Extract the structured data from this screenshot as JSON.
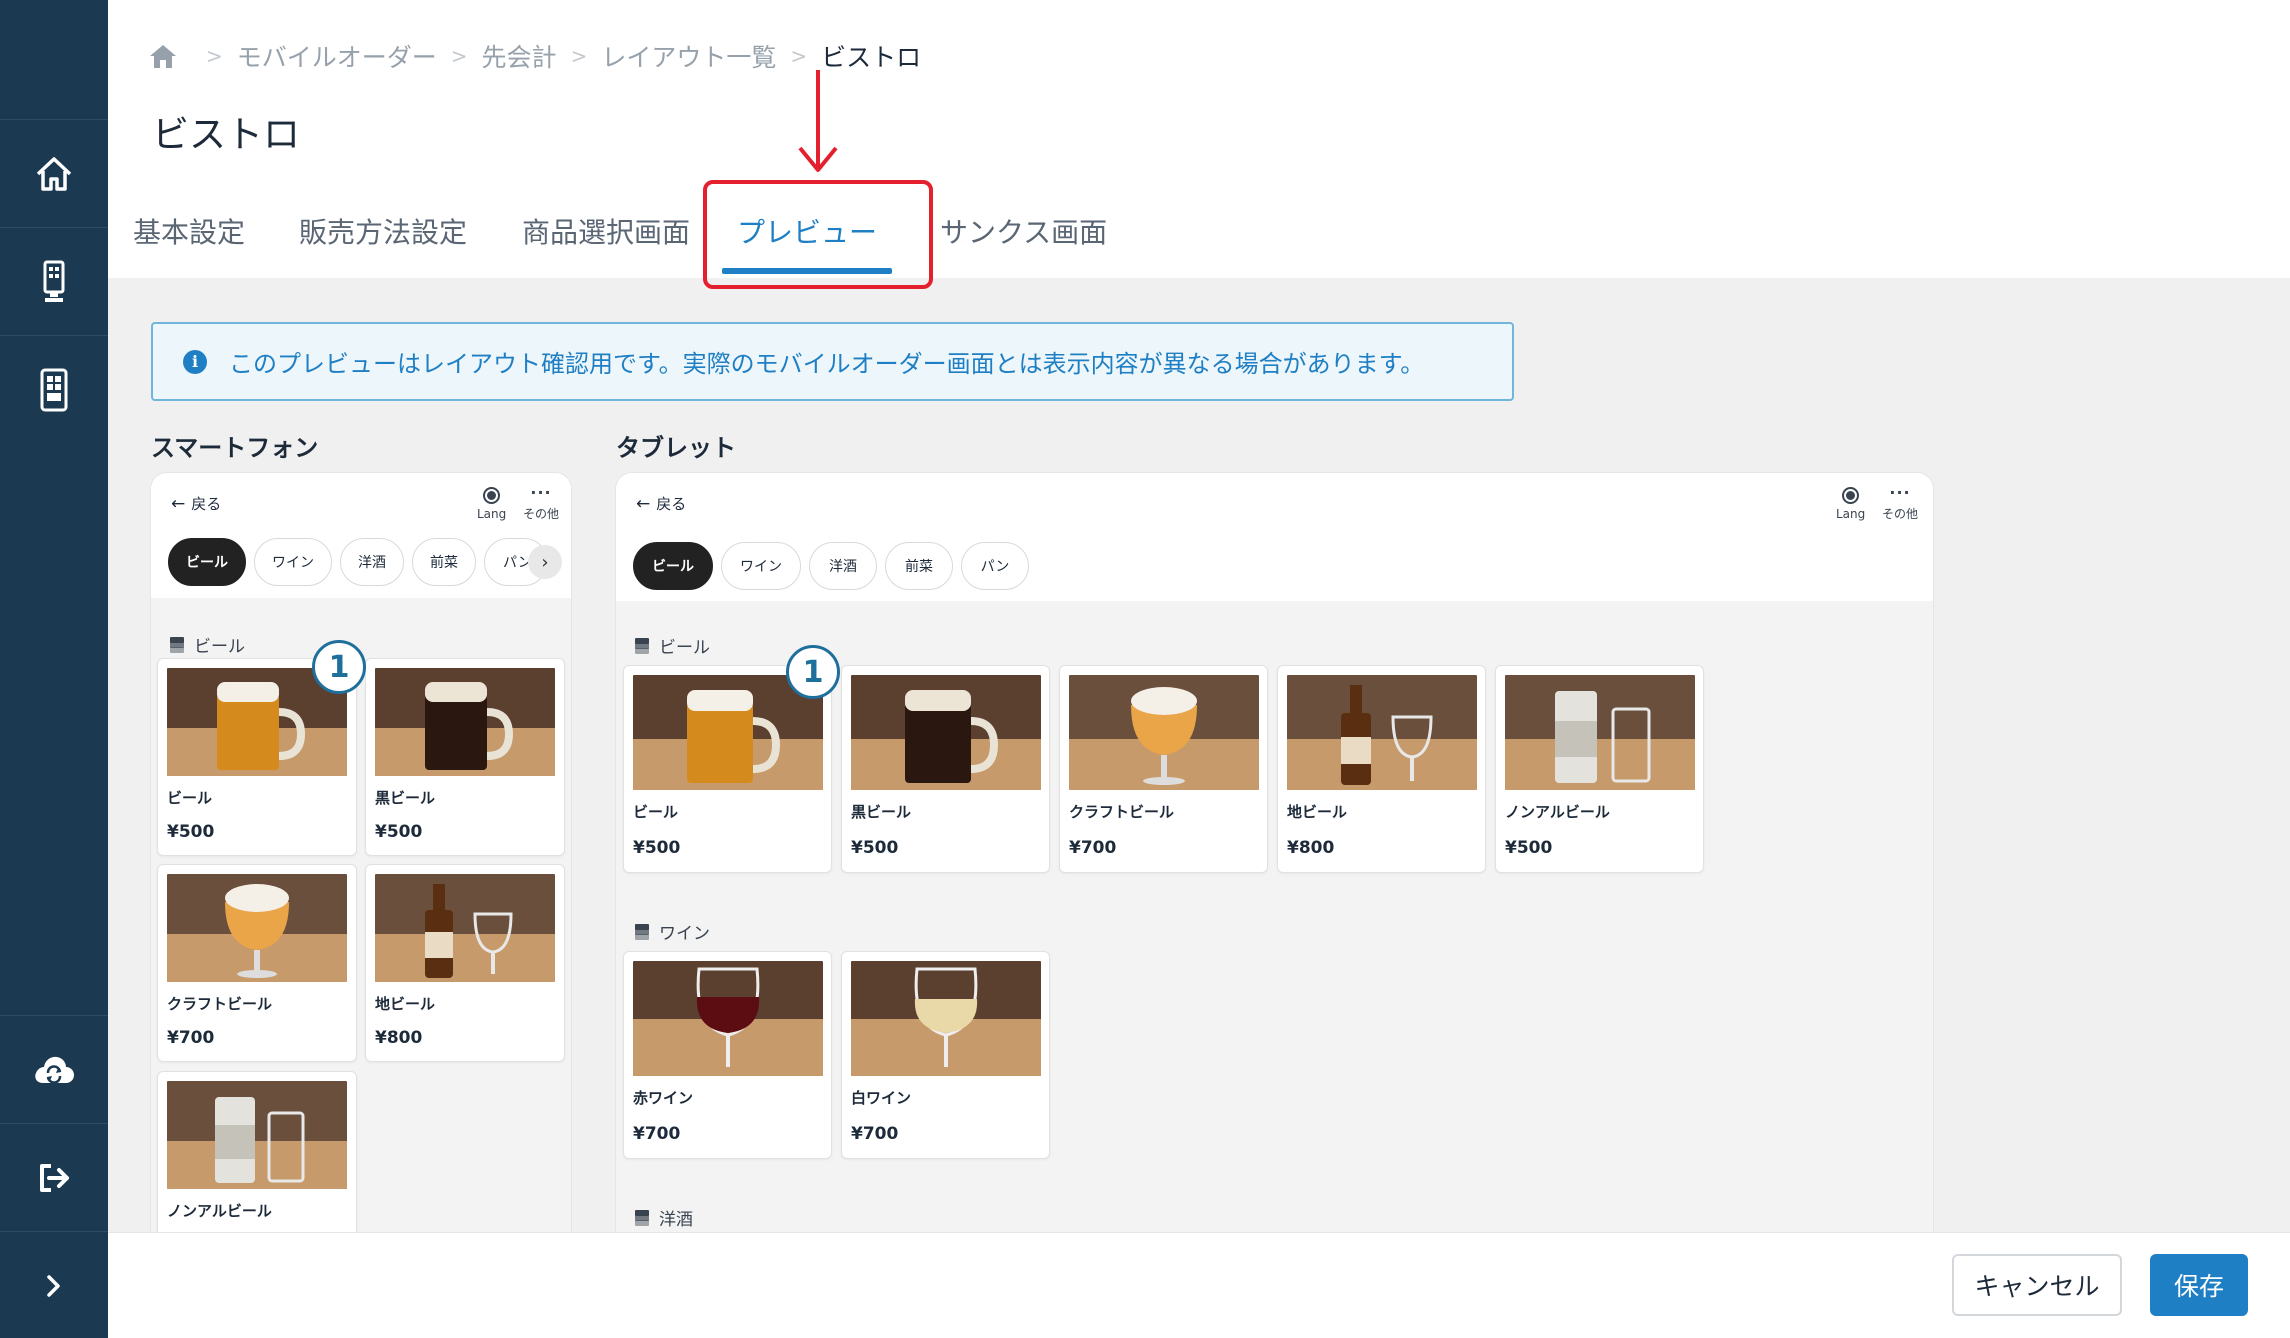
{
  "breadcrumb": [
    "モバイルオーダー",
    "先会計",
    "レイアウト一覧",
    "ビストロ"
  ],
  "page_title": "ビストロ",
  "tabs": [
    "基本設定",
    "販売方法設定",
    "商品選択画面",
    "プレビュー",
    "サンクス画面"
  ],
  "active_tab": "プレビュー",
  "notice": "このプレビューはレイアウト確認用です。実際のモバイルオーダー画面とは表示内容が異なる場合があります。",
  "preview": {
    "smartphone_label": "スマートフォン",
    "tablet_label": "タブレット",
    "back_label": "戻る",
    "lang_label": "Lang",
    "more_label": "その他",
    "categories": [
      "ビール",
      "ワイン",
      "洋酒",
      "前菜",
      "パン"
    ],
    "sections": {
      "beer": "ビール",
      "wine": "ワイン",
      "spirits": "洋酒"
    },
    "beer_items": [
      {
        "name": "ビール",
        "price": "¥500"
      },
      {
        "name": "黒ビール",
        "price": "¥500"
      },
      {
        "name": "クラフトビール",
        "price": "¥700"
      },
      {
        "name": "地ビール",
        "price": "¥800"
      },
      {
        "name": "ノンアルビール",
        "price": "¥500"
      }
    ],
    "wine_items": [
      {
        "name": "赤ワイン",
        "price": "¥700"
      },
      {
        "name": "白ワイン",
        "price": "¥700"
      }
    ],
    "badge": "1"
  },
  "footer": {
    "cancel": "キャンセル",
    "save": "保存"
  },
  "colors": {
    "sidebar": "#1b3a52",
    "accent": "#1f7fc4",
    "annotation": "#e5202e"
  }
}
